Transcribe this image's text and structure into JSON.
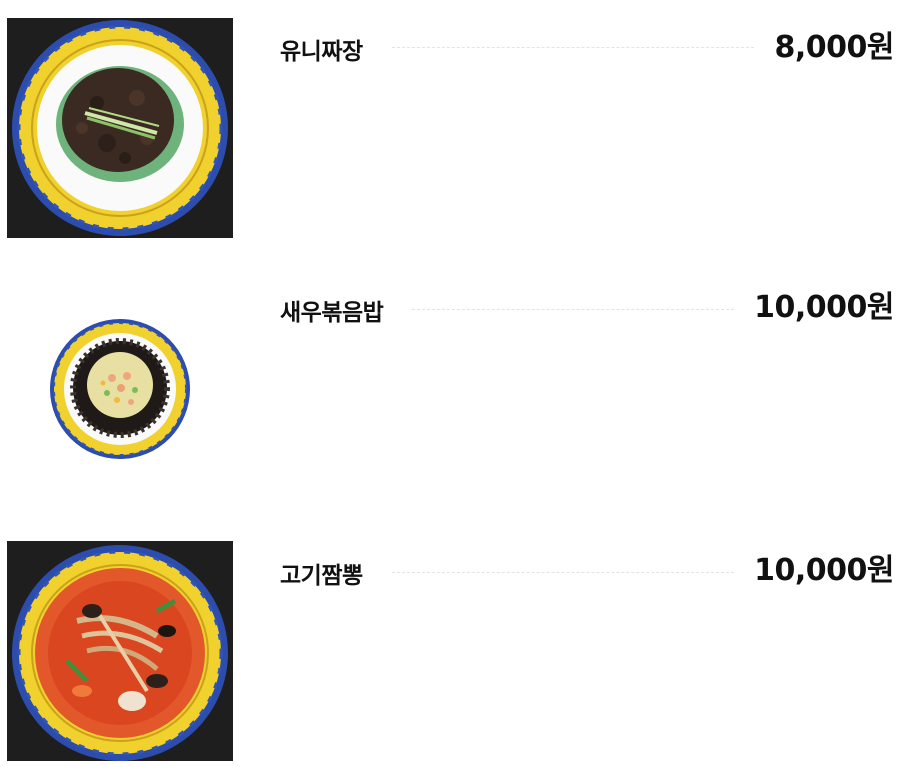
{
  "menu": {
    "items": [
      {
        "name": "유니짜장",
        "price": "8,000원",
        "image": "jjajang-dish-photo"
      },
      {
        "name": "새우볶음밥",
        "price": "10,000원",
        "image": "shrimp-fried-rice-dish-photo"
      },
      {
        "name": "고기짬뽕",
        "price": "10,000원",
        "image": "meat-jjamppong-dish-photo"
      }
    ]
  },
  "colors": {
    "text": "#111111",
    "photo_background": "#1e1e1e",
    "leader_line": "#e3e3e3",
    "plate_rim": "#f2d230",
    "plate_edge": "#2a4fb0"
  }
}
